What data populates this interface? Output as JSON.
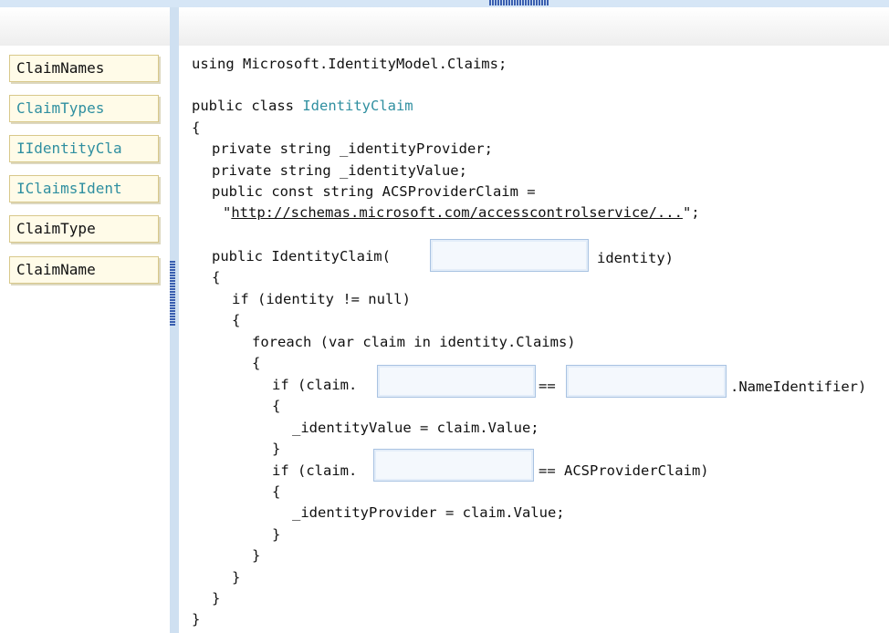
{
  "answer_choices": [
    {
      "label": "ClaimNames",
      "color": "#111111"
    },
    {
      "label": "ClaimTypes",
      "color": "#2f8fa0"
    },
    {
      "label": "IIdentityCla",
      "color": "#2f8fa0"
    },
    {
      "label": "IClaimsIdent",
      "color": "#2f8fa0"
    },
    {
      "label": "ClaimType",
      "color": "#111111"
    },
    {
      "label": "ClaimName",
      "color": "#111111"
    }
  ],
  "code": {
    "using_line": "using Microsoft.IdentityModel.Claims;",
    "class_prefix": "public class ",
    "class_name": "IdentityClaim",
    "open_brace": "{",
    "field_provider": "private string _identityProvider;",
    "field_value": "private string _identityValue;",
    "const_line": "public const string ACSProviderClaim =",
    "const_quote_open": "\"",
    "const_url": "http://schemas.microsoft.com/accesscontrolservice/...",
    "const_quote_close": "\";",
    "ctor_prefix": "public IdentityClaim(",
    "ctor_suffix": "identity)",
    "ctor_open": "{",
    "if_null": "if (identity != null)",
    "if_open": "{",
    "foreach_line": "foreach (var claim in identity.Claims)",
    "foreach_open": "{",
    "if1_prefix": "if (claim.",
    "if1_eq": "==",
    "if1_suffix": ".NameIdentifier)",
    "if1_open": "{",
    "assign_value": "_identityValue = claim.Value;",
    "if1_close": "}",
    "if2_prefix": "if (claim.",
    "if2_suffix": "== ACSProviderClaim)",
    "if2_open": "{",
    "assign_provider": "_identityProvider = claim.Value;",
    "if2_close": "}",
    "foreach_close": "}",
    "if_close": "}",
    "ctor_close": "}",
    "class_close": "}"
  },
  "colors": {
    "type_name": "#2f8fa0",
    "splitter": "#cfe0f1",
    "drop_border": "#a9c3e2"
  }
}
